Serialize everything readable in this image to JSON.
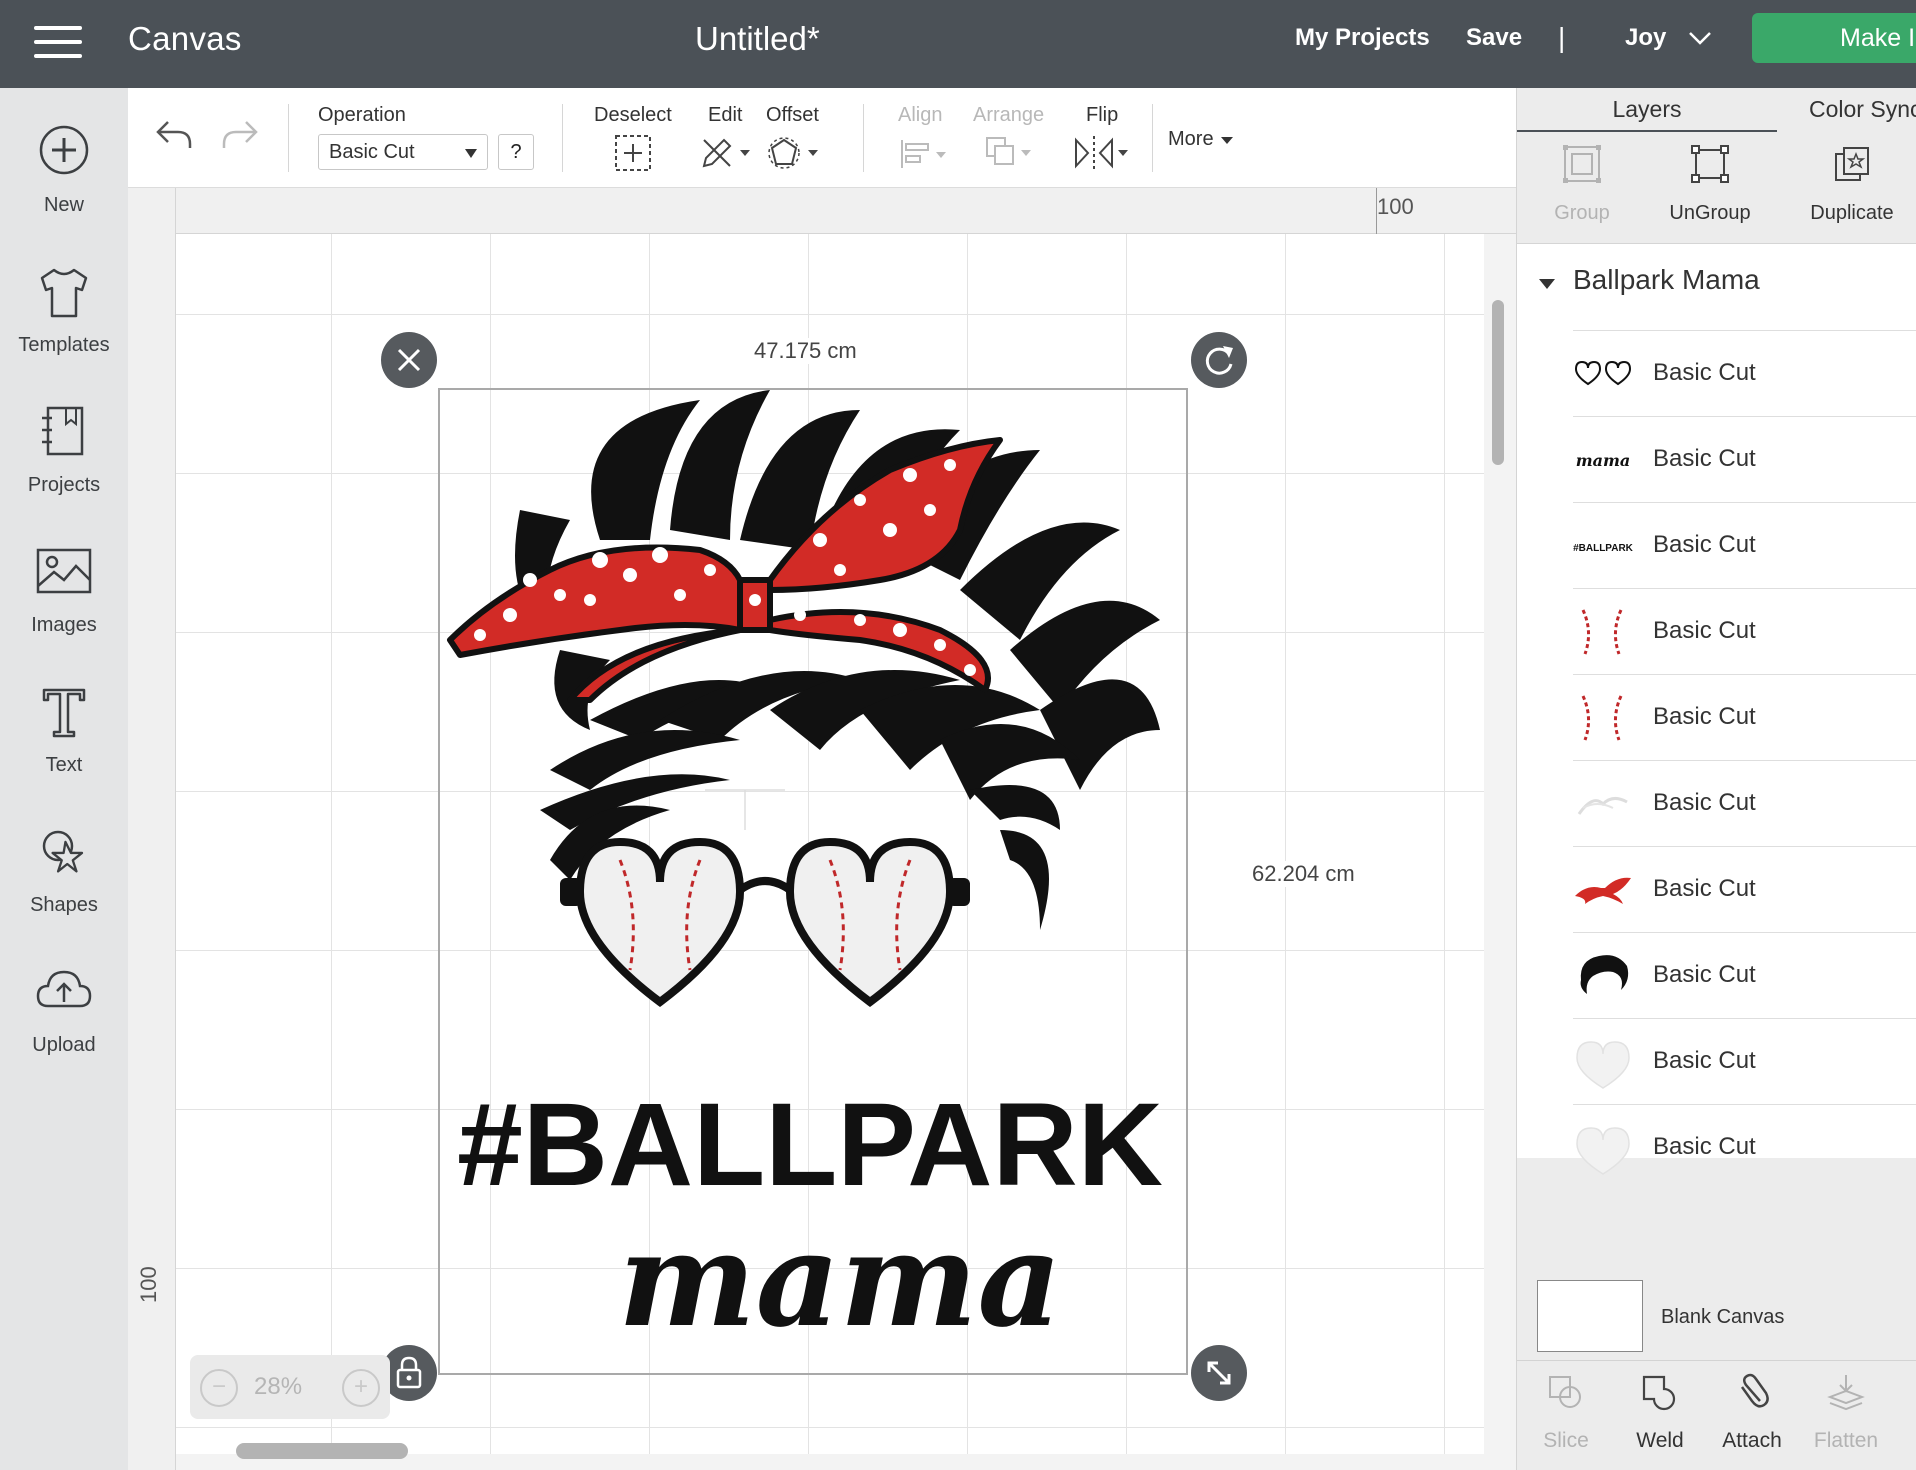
{
  "header": {
    "app_name": "Canvas",
    "doc_title": "Untitled*",
    "my_projects": "My Projects",
    "save": "Save",
    "divider": "|",
    "machine": "Joy",
    "make": "Make I",
    "make_color": "#3aa869",
    "bg_color": "#4b5157"
  },
  "left_nav": {
    "items": [
      {
        "label": "New",
        "icon": "plus-circle-icon"
      },
      {
        "label": "Templates",
        "icon": "tshirt-icon"
      },
      {
        "label": "Projects",
        "icon": "notebook-icon"
      },
      {
        "label": "Images",
        "icon": "image-icon"
      },
      {
        "label": "Text",
        "icon": "text-t-icon"
      },
      {
        "label": "Shapes",
        "icon": "shapes-icon"
      },
      {
        "label": "Upload",
        "icon": "cloud-upload-icon"
      }
    ]
  },
  "toolbar": {
    "operation_label": "Operation",
    "operation_value": "Basic Cut",
    "help": "?",
    "deselect": "Deselect",
    "edit": "Edit",
    "offset": "Offset",
    "align": "Align",
    "arrange": "Arrange",
    "flip": "Flip",
    "more": "More"
  },
  "canvas": {
    "ruler_top": "100",
    "ruler_left": "100",
    "width_label": "47.175 cm",
    "height_label": "62.204 cm",
    "zoom": "28%",
    "zoom_out": "−",
    "zoom_in": "+",
    "art_text_1": "#BALLPARK",
    "art_text_2": "mama",
    "bandana_color": "#d22b26"
  },
  "layers_panel": {
    "tab_layers": "Layers",
    "tab_color": "Color Sync",
    "group": "Group",
    "ungroup": "UnGroup",
    "duplicate": "Duplicate",
    "group_name": "Ballpark Mama",
    "thumb_mama": "mama",
    "thumb_ballpark": "#BALLPARK",
    "layers": [
      {
        "name": "Basic Cut",
        "thumb": "heart-glasses-thumb"
      },
      {
        "name": "Basic Cut",
        "thumb": "mama-text-thumb"
      },
      {
        "name": "Basic Cut",
        "thumb": "ballpark-text-thumb"
      },
      {
        "name": "Basic Cut",
        "thumb": "stitches-thumb"
      },
      {
        "name": "Basic Cut",
        "thumb": "stitches-thumb"
      },
      {
        "name": "Basic Cut",
        "thumb": "faint-hair-thumb"
      },
      {
        "name": "Basic Cut",
        "thumb": "red-bandana-thumb"
      },
      {
        "name": "Basic Cut",
        "thumb": "black-hair-thumb"
      },
      {
        "name": "Basic Cut",
        "thumb": "white-heart-thumb"
      },
      {
        "name": "Basic Cut",
        "thumb": "white-heart-thumb"
      }
    ],
    "blank_canvas": "Blank Canvas",
    "slice": "Slice",
    "weld": "Weld",
    "attach": "Attach",
    "flatten": "Flatten"
  }
}
